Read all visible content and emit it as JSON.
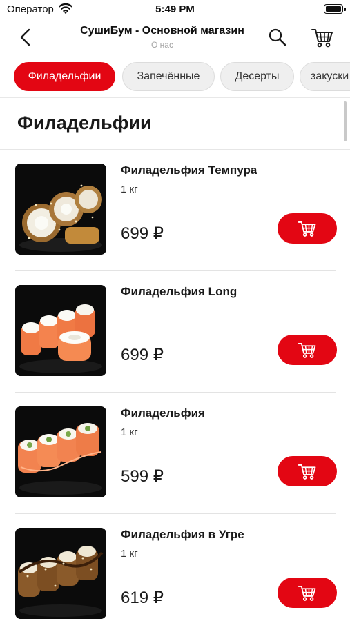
{
  "status_bar": {
    "carrier": "Оператор",
    "time": "5:49 PM"
  },
  "nav": {
    "title": "СушиБум - Основной магазин",
    "subtitle": "О нас"
  },
  "categories": [
    {
      "label": "Филадельфии",
      "active": true
    },
    {
      "label": "Запечённые",
      "active": false
    },
    {
      "label": "Десерты",
      "active": false
    },
    {
      "label": "закуски",
      "active": false
    }
  ],
  "section": {
    "title": "Филадельфии"
  },
  "products": [
    {
      "name": "Филадельфия Темпура",
      "weight": "1 кг",
      "price": "699 ₽"
    },
    {
      "name": "Филадельфия Long",
      "weight": "",
      "price": "699 ₽"
    },
    {
      "name": "Филадельфия",
      "weight": "1 кг",
      "price": "599 ₽"
    },
    {
      "name": "Филадельфия в Угре",
      "weight": "1 кг",
      "price": "619 ₽"
    }
  ],
  "colors": {
    "accent": "#e30613",
    "chip_bg": "#efefef",
    "subtitle": "#a3a3a3"
  },
  "icons": {
    "back": "chevron-left-icon",
    "search": "magnifier-icon",
    "cart": "shopping-cart-icon",
    "add_to_cart": "shopping-cart-icon",
    "wifi": "wifi-icon",
    "battery": "battery-icon"
  }
}
